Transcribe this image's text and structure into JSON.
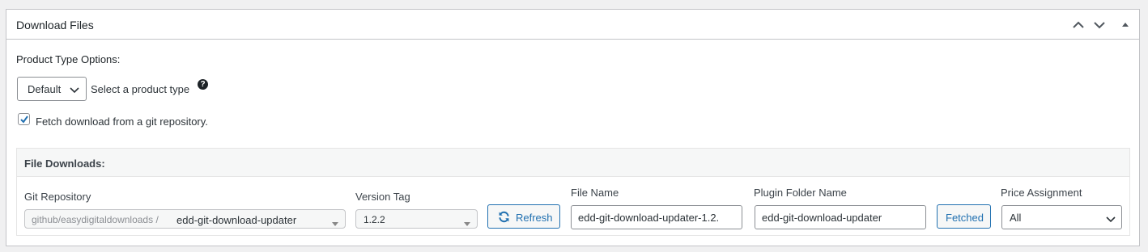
{
  "metabox": {
    "title": "Download Files",
    "header_icons": [
      "chevron-up-icon",
      "chevron-down-icon",
      "toggle-arrow-icon"
    ]
  },
  "product_type": {
    "label": "Product Type Options:",
    "selected": "Default",
    "hint": "Select a product type",
    "help_glyph": "?"
  },
  "git_fetch": {
    "checked": true,
    "label": "Fetch download from a git repository."
  },
  "file_downloads": {
    "title": "File Downloads:",
    "git_repository": {
      "label": "Git Repository",
      "prefix": "github/easydigitaldownloads /",
      "repo": "edd-git-download-updater"
    },
    "version_tag": {
      "label": "Version Tag",
      "value": "1.2.2"
    },
    "refresh_button": "Refresh",
    "file_name": {
      "label": "File Name",
      "value": "edd-git-download-updater-1.2."
    },
    "plugin_folder": {
      "label": "Plugin Folder Name",
      "value": "edd-git-download-updater"
    },
    "fetched_button": "Fetched",
    "price_assignment": {
      "label": "Price Assignment",
      "selected": "All"
    }
  },
  "colors": {
    "accent": "#2271b1",
    "border": "#c3c4c7",
    "background": "#f0f0f1"
  }
}
